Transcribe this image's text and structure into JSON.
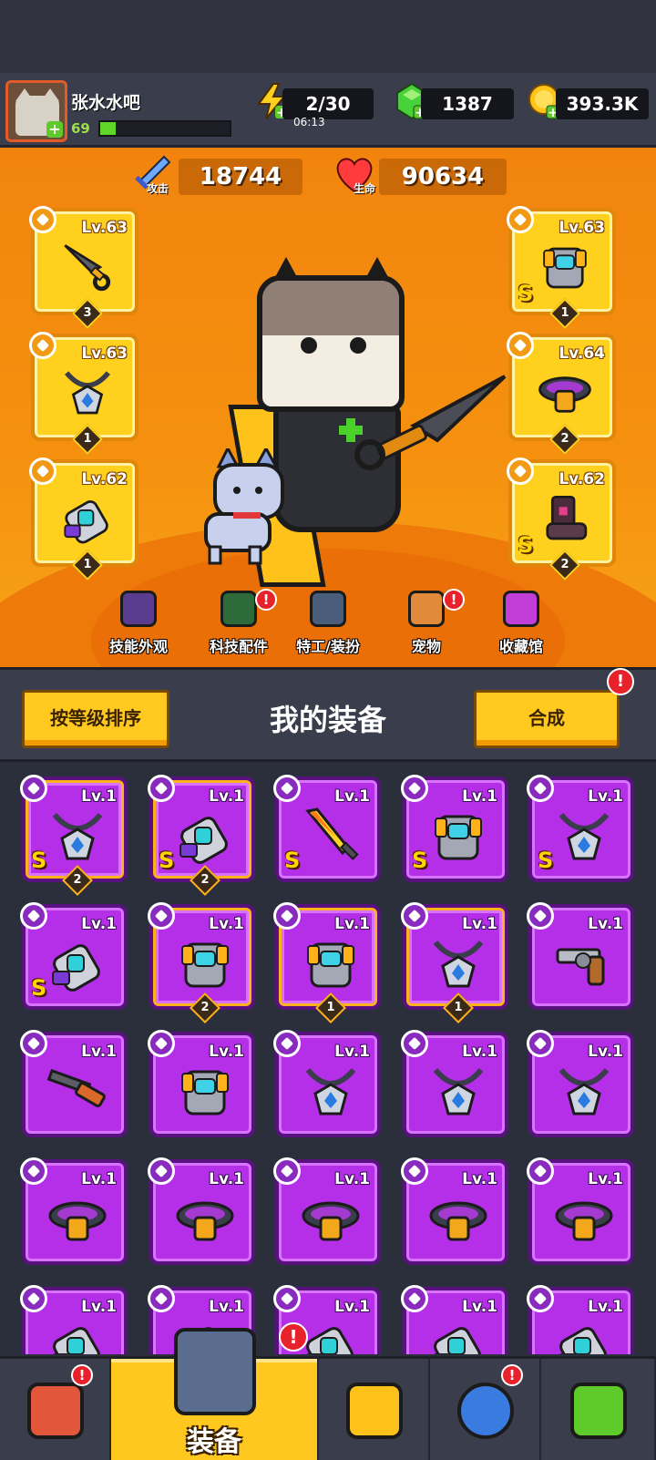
{
  "player": {
    "name": "张水水吧",
    "level": "69",
    "xp_fraction": 0.12
  },
  "resources": {
    "energy": "2/30",
    "energy_timer": "06:13",
    "gems": "1387",
    "coins": "393.3K"
  },
  "hero": {
    "attack_label": "攻击",
    "attack_value": "18744",
    "hp_label": "生命",
    "hp_value": "90634"
  },
  "slots": [
    {
      "side": "left",
      "type": "weapon-icon",
      "lv": "Lv.63",
      "stars": "3",
      "s_rank": ""
    },
    {
      "side": "left",
      "type": "necklace-icon",
      "lv": "Lv.63",
      "stars": "1",
      "s_rank": ""
    },
    {
      "side": "left",
      "type": "glove-icon",
      "lv": "Lv.62",
      "stars": "1",
      "s_rank": ""
    },
    {
      "side": "right",
      "type": "armor-icon",
      "lv": "Lv.63",
      "stars": "1",
      "s_rank": "S"
    },
    {
      "side": "right",
      "type": "belt-icon",
      "lv": "Lv.64",
      "stars": "2",
      "s_rank": ""
    },
    {
      "side": "right",
      "type": "boots-icon",
      "lv": "Lv.62",
      "stars": "2",
      "s_rank": "S"
    }
  ],
  "hero_menu": [
    {
      "label": "技能外观",
      "icon": "skill-skin-icon",
      "alert": false,
      "color": "#5a3d8f"
    },
    {
      "label": "科技配件",
      "icon": "tech-part-icon",
      "alert": true,
      "color": "#2d6b3a"
    },
    {
      "label": "特工/装扮",
      "icon": "agent-outfit-icon",
      "alert": false,
      "color": "#4a5d7a"
    },
    {
      "label": "宠物",
      "icon": "pet-icon",
      "alert": true,
      "color": "#e08a3a"
    },
    {
      "label": "收藏馆",
      "icon": "collection-icon",
      "alert": false,
      "color": "#c23ed8"
    }
  ],
  "equipment": {
    "sort_button": "按等级排序",
    "title": "我的装备",
    "merge_button": "合成",
    "merge_alert": "!"
  },
  "items": [
    {
      "lv": "Lv.1",
      "icon": "necklace-icon",
      "s_rank": "S",
      "stars": "2",
      "framed": true
    },
    {
      "lv": "Lv.1",
      "icon": "glove-icon",
      "s_rank": "S",
      "stars": "2",
      "framed": true
    },
    {
      "lv": "Lv.1",
      "icon": "sword-icon",
      "s_rank": "S",
      "stars": "",
      "framed": false
    },
    {
      "lv": "Lv.1",
      "icon": "armor-icon",
      "s_rank": "S",
      "stars": "",
      "framed": false
    },
    {
      "lv": "Lv.1",
      "icon": "necklace-icon",
      "s_rank": "S",
      "stars": "",
      "framed": false
    },
    {
      "lv": "Lv.1",
      "icon": "glove-icon",
      "s_rank": "S",
      "stars": "",
      "framed": false
    },
    {
      "lv": "Lv.1",
      "icon": "armor-icon",
      "s_rank": "",
      "stars": "2",
      "framed": true
    },
    {
      "lv": "Lv.1",
      "icon": "armor-icon",
      "s_rank": "",
      "stars": "1",
      "framed": true
    },
    {
      "lv": "Lv.1",
      "icon": "necklace-icon",
      "s_rank": "",
      "stars": "1",
      "framed": true
    },
    {
      "lv": "Lv.1",
      "icon": "revolver-icon",
      "s_rank": "",
      "stars": "",
      "framed": false
    },
    {
      "lv": "Lv.1",
      "icon": "shotgun-icon",
      "s_rank": "",
      "stars": "",
      "framed": false
    },
    {
      "lv": "Lv.1",
      "icon": "armor-icon",
      "s_rank": "",
      "stars": "",
      "framed": false
    },
    {
      "lv": "Lv.1",
      "icon": "necklace-icon",
      "s_rank": "",
      "stars": "",
      "framed": false
    },
    {
      "lv": "Lv.1",
      "icon": "necklace-icon",
      "s_rank": "",
      "stars": "",
      "framed": false
    },
    {
      "lv": "Lv.1",
      "icon": "necklace-icon",
      "s_rank": "",
      "stars": "",
      "framed": false
    },
    {
      "lv": "Lv.1",
      "icon": "belt-icon",
      "s_rank": "",
      "stars": "",
      "framed": false
    },
    {
      "lv": "Lv.1",
      "icon": "belt-icon",
      "s_rank": "",
      "stars": "",
      "framed": false
    },
    {
      "lv": "Lv.1",
      "icon": "belt-icon",
      "s_rank": "",
      "stars": "",
      "framed": false
    },
    {
      "lv": "Lv.1",
      "icon": "belt-icon",
      "s_rank": "",
      "stars": "",
      "framed": false
    },
    {
      "lv": "Lv.1",
      "icon": "belt-icon",
      "s_rank": "",
      "stars": "",
      "framed": false
    },
    {
      "lv": "Lv.1",
      "icon": "glove-icon",
      "s_rank": "",
      "stars": "",
      "framed": false
    },
    {
      "lv": "Lv.1",
      "icon": "glove-icon",
      "s_rank": "",
      "stars": "",
      "framed": false
    },
    {
      "lv": "Lv.1",
      "icon": "glove-icon",
      "s_rank": "",
      "stars": "",
      "framed": false
    },
    {
      "lv": "Lv.1",
      "icon": "glove-icon",
      "s_rank": "",
      "stars": "",
      "framed": false
    },
    {
      "lv": "Lv.1",
      "icon": "glove-icon",
      "s_rank": "",
      "stars": "",
      "framed": false
    }
  ],
  "bottom_nav": [
    {
      "label": "",
      "icon": "shop-icon",
      "alert": true,
      "active": false
    },
    {
      "label": "装备",
      "icon": "equipment-icon",
      "alert": true,
      "active": true
    },
    {
      "label": "",
      "icon": "battle-icon",
      "alert": false,
      "active": false
    },
    {
      "label": "",
      "icon": "planet-icon",
      "alert": true,
      "active": false
    },
    {
      "label": "",
      "icon": "gene-icon",
      "alert": false,
      "active": false
    }
  ],
  "colors": {
    "hero_orange": "#f5910f",
    "slot_yellow": "#ffd01d",
    "item_purple": "#b52ee8",
    "button_yellow": "#ffc91f",
    "alert_red": "#e8222a"
  }
}
